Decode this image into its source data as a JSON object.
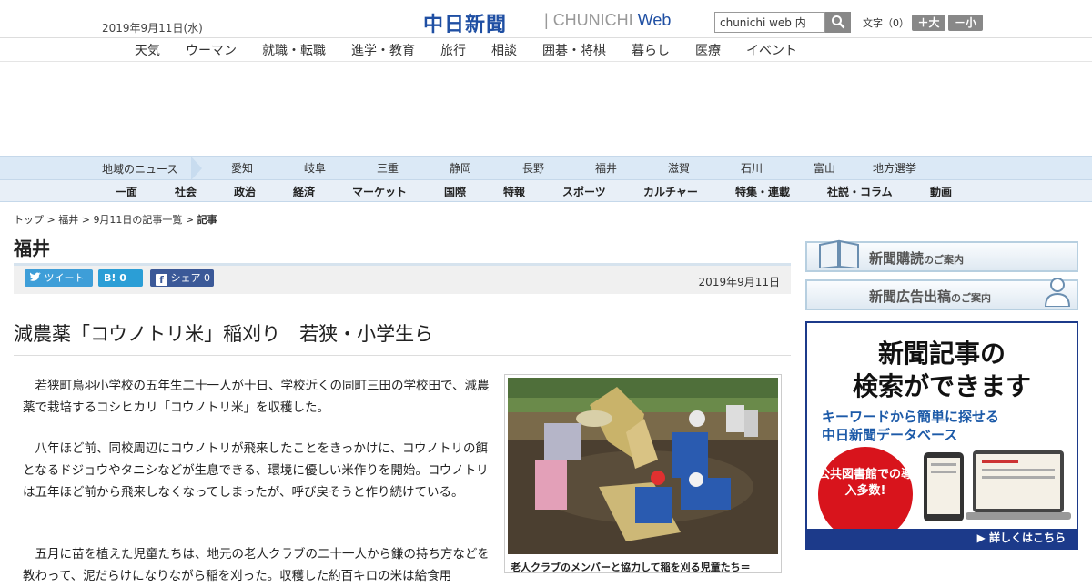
{
  "header": {
    "date": "2019年9月11日(水)",
    "logo": "中日新聞",
    "logo_sub": "CHUNICHI",
    "logo_web": "Web",
    "search_placeholder": "chunichi web 内",
    "font_label": "文字（0）",
    "font_big": "＋大",
    "font_small": "－小"
  },
  "subnav": [
    "天気",
    "ウーマン",
    "就職・転職",
    "進学・教育",
    "旅行",
    "相談",
    "囲碁・将棋",
    "暮らし",
    "医療",
    "イベント"
  ],
  "region": {
    "label": "地域のニュース",
    "items": [
      "愛知",
      "岐阜",
      "三重",
      "静岡",
      "長野",
      "福井",
      "滋賀",
      "石川",
      "富山",
      "地方選挙"
    ]
  },
  "mainnav": [
    "一面",
    "社会",
    "政治",
    "経済",
    "マーケット",
    "国際",
    "特報",
    "スポーツ",
    "カルチャー",
    "特集・連載",
    "社説・コラム",
    "動画"
  ],
  "breadcrumb": {
    "top": "トップ",
    "region": "福井",
    "list": "9月11日の記事一覧",
    "current": "記事"
  },
  "section_title": "福井",
  "share": {
    "tweet": "ツイート",
    "hatena": "B! 0",
    "facebook": "シェア 0",
    "date": "2019年9月11日"
  },
  "article": {
    "headline": "減農薬「コウノトリ米」稲刈り　若狭・小学生ら",
    "p1": "　若狭町鳥羽小学校の五年生二十一人が十日、学校近くの同町三田の学校田で、減農薬で栽培するコシヒカリ「コウノトリ米」を収穫した。",
    "p2": "　八年ほど前、同校周辺にコウノトリが飛来したことをきっかけに、コウノトリの餌となるドジョウやタニシなどが生息できる、環境に優しい米作りを開始。コウノトリは五年ほど前から飛来しなくなってしまったが、呼び戻そうと作り続けている。",
    "p3": "　五月に苗を植えた児童たちは、地元の老人クラブの二十一人から鎌の持ち方などを教わって、泥だらけになりながら稲を刈った。収穫した約百キロの米は給食用",
    "caption": "老人クラブのメンバーと協力して稲を刈る児童たち＝"
  },
  "sidebar": {
    "banner1_big": "新聞購読",
    "banner1_small": "のご案内",
    "banner2_big": "新聞広告出稿",
    "banner2_small": "のご案内",
    "ad_line1": "新聞記事の",
    "ad_line2": "検索ができます",
    "ad_line3": "キーワードから簡単に探せる",
    "ad_line4": "中日新聞データベース",
    "ad_circle": "公共図書館での導入多数!",
    "ad_link": "▶ 詳しくはこちら"
  }
}
